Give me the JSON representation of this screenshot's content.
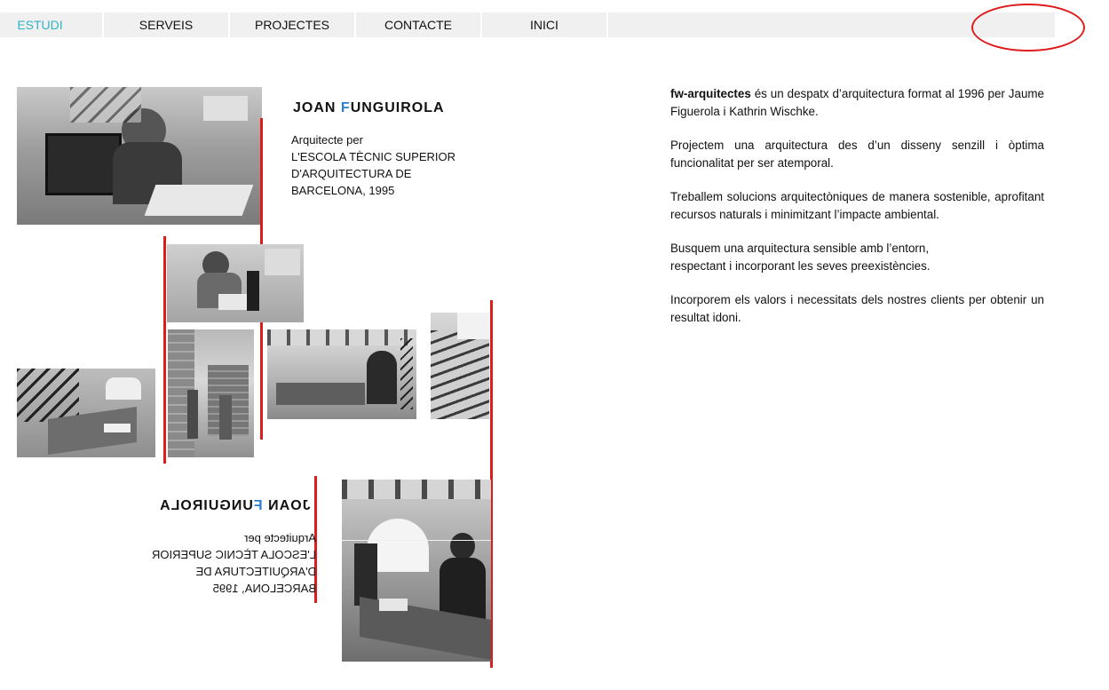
{
  "nav": {
    "items": [
      {
        "label": "ESTUDI",
        "active": true
      },
      {
        "label": "SERVEIS",
        "active": false
      },
      {
        "label": "PROJECTES",
        "active": false
      },
      {
        "label": "CONTACTE",
        "active": false
      },
      {
        "label": "INICI",
        "active": false
      }
    ],
    "active_color": "#2fb3c6"
  },
  "profile1": {
    "name_first": "JOAN ",
    "name_accent": "F",
    "name_rest": "UNGUIROLA",
    "bio_lines": [
      "Arquitecte per",
      "L'ESCOLA TÈCNIC SUPERIOR",
      "D'ARQUITECTURA DE",
      "BARCELONA, 1995"
    ]
  },
  "profile2": {
    "name_first": "JOAN ",
    "name_accent": "F",
    "name_rest": "UNGUIROLA",
    "bio_lines": [
      "Arquitecte per",
      "L'ESCOLA TÈCNIC SUPERIOR",
      "D'ARQUITECTURA DE",
      "BARCELONA, 1995"
    ]
  },
  "about": {
    "brand": "fw-arquitectes",
    "p1_rest": " és un despatx d’arquitectura format al 1996 per Jaume Figuerola i Kathrin Wischke.",
    "p2": "Projectem una arquitectura des d’un disseny senzill i òptima funcionalitat per ser atemporal.",
    "p3": "Treballem solucions arquitectòniques de manera sostenible, aprofitant recursos naturals i minimitzant l’impacte ambiental.",
    "p4a": "Busquem una arquitectura sensible amb l’entorn,",
    "p4b": "respectant i incorporant les seves preexistències.",
    "p5": "Incorporem els valors i necessitats dels nostres clients per obtenir un resultat idoni."
  },
  "colors": {
    "accent_line": "#dd1c1c",
    "name_accent": "#2a7fd4"
  }
}
